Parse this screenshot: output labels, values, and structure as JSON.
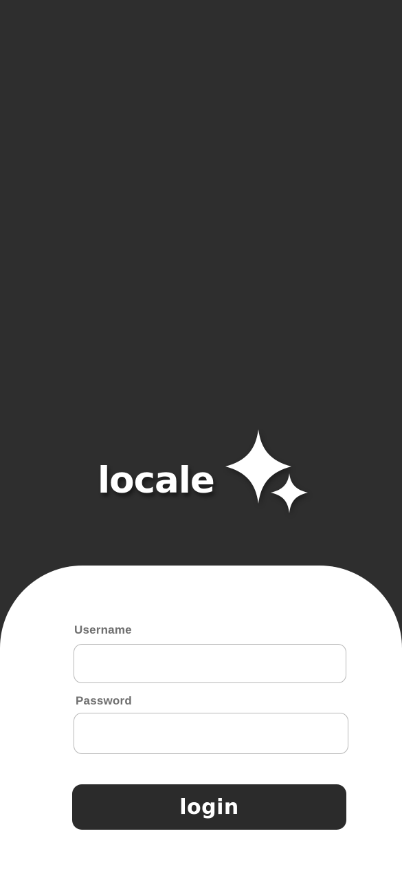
{
  "brand": {
    "name": "locale",
    "logo_icon": "sparkle-icon"
  },
  "login_form": {
    "username_label": "Username",
    "username_value": "",
    "password_label": "Password",
    "password_value": "",
    "login_label": "login"
  },
  "colors": {
    "background": "#2e2e2e",
    "card": "#ffffff",
    "button": "#2b2b2b",
    "label_text": "#6f6f6f",
    "input_border": "#b8b8b8"
  }
}
